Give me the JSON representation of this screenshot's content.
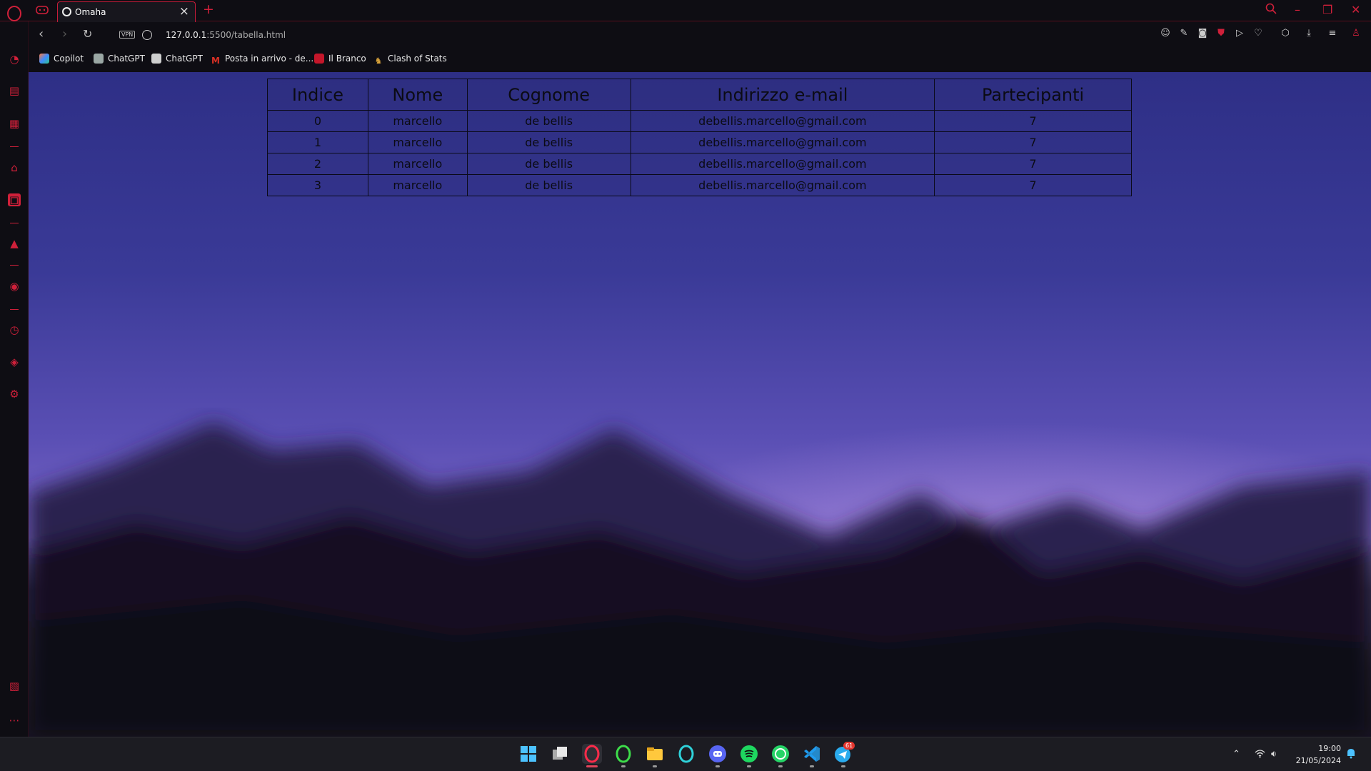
{
  "browser": {
    "tab_title": "Omaha",
    "url_host": "127.0.0.1",
    "url_path": ":5500/tabella.html",
    "vpn_label": "VPN"
  },
  "bookmarks": [
    {
      "label": "Copilot",
      "icon": "copilot-icon",
      "color": "#4aa3ff"
    },
    {
      "label": "ChatGPT",
      "icon": "chatgpt-icon",
      "color": "#9aa7a4"
    },
    {
      "label": "ChatGPT",
      "icon": "chatgpt-icon",
      "color": "#cfcfcf"
    },
    {
      "label": "Posta in arrivo - de...",
      "icon": "gmail-icon",
      "color": "#d93025"
    },
    {
      "label": "Il Branco",
      "icon": "sk-icon",
      "color": "#c4162a"
    },
    {
      "label": "Clash of Stats",
      "icon": "clash-icon",
      "color": "#d8a23a"
    }
  ],
  "table": {
    "headers": [
      "Indice",
      "Nome",
      "Cognome",
      "Indirizzo e-mail",
      "Partecipanti"
    ],
    "rows": [
      [
        "0",
        "marcello",
        "de bellis",
        "debellis.marcello@gmail.com",
        "7"
      ],
      [
        "1",
        "marcello",
        "de bellis",
        "debellis.marcello@gmail.com",
        "7"
      ],
      [
        "2",
        "marcello",
        "de bellis",
        "debellis.marcello@gmail.com",
        "7"
      ],
      [
        "3",
        "marcello",
        "de bellis",
        "debellis.marcello@gmail.com",
        "7"
      ]
    ]
  },
  "taskbar": {
    "time": "19:00",
    "date": "21/05/2024",
    "telegram_badge": "61"
  },
  "colors": {
    "accent": "#d0203a",
    "taskbar_bg": "#1c1c22"
  }
}
